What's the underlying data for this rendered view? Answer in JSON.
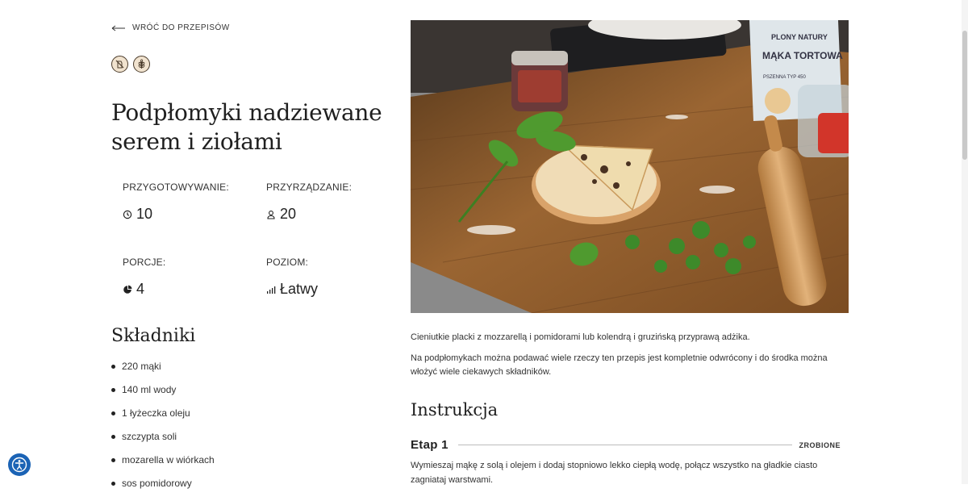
{
  "nav": {
    "back_label": "WRÓĆ DO PRZEPISÓW"
  },
  "badges": [
    {
      "icon": "no-lactose-icon"
    },
    {
      "icon": "wheat-icon"
    }
  ],
  "recipe": {
    "title": "Podpłomyki nadziewane serem i ziołami",
    "stats": {
      "prep": {
        "label": "PRZYGOTOWYWANIE:",
        "value": "10",
        "icon": "clock-icon"
      },
      "cook": {
        "label": "PRZYRZĄDZANIE:",
        "value": "20",
        "icon": "chef-icon"
      },
      "portions": {
        "label": "PORCJE:",
        "value": "4",
        "icon": "pie-icon"
      },
      "level": {
        "label": "POZIOM:",
        "value": "Łatwy",
        "icon": "bars-icon"
      }
    }
  },
  "ingredients": {
    "title": "Składniki",
    "items": [
      "220 mąki",
      "140 ml wody",
      "1 łyżeczka oleju",
      "szczypta soli",
      "mozarella w wiórkach",
      "sos pomidorowy"
    ]
  },
  "description": {
    "paragraphs": [
      "Cieniutkie placki z mozzarellą i pomidorami lub kolendrą  i gruzińską przyprawą adżika.",
      "Na podpłomykach można podawać wiele rzeczy  ten przepis jest kompletnie odwrócony i do środka można włożyć wiele ciekawych składników."
    ]
  },
  "photo": {
    "bag_brand": "PLONY NATURY",
    "bag_product": "MĄKA TORTOWA",
    "bag_subtitle": "PSZENNA TYP 450"
  },
  "instructions": {
    "title": "Instrukcja",
    "steps": [
      {
        "label": "Etap 1",
        "done_label": "ZROBIONE",
        "text": "Wymieszaj mąkę z solą i olejem i dodaj stopniowo lekko ciepłą wodę, połącz wszystko na gładkie ciasto zagniataj warstwami."
      }
    ]
  },
  "colors": {
    "accent_blue": "#1b63b5",
    "badge_bg": "#f1e3cf"
  }
}
